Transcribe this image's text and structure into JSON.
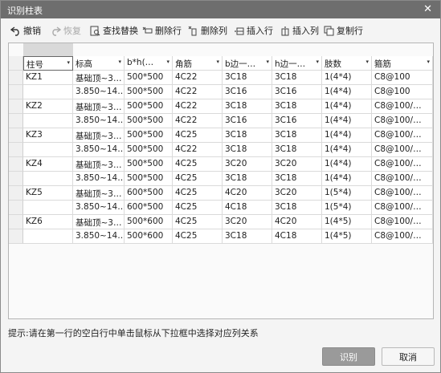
{
  "window": {
    "title": "识别柱表",
    "close_glyph": "✕"
  },
  "toolbar": {
    "undo": "撤销",
    "redo": "恢复",
    "find_replace": "查找替换",
    "delete_row": "删除行",
    "delete_col": "删除列",
    "insert_row": "插入行",
    "insert_col": "插入列",
    "copy_row": "复制行"
  },
  "table": {
    "headers": [
      "柱号",
      "标高",
      "b*h(…",
      "角筋",
      "b边一…",
      "h边一…",
      "肢数",
      "箍筋"
    ],
    "rows": [
      [
        "KZ1",
        "基础顶~3…",
        "500*500",
        "4C22",
        "3C18",
        "3C18",
        "1(4*4)",
        "C8@100"
      ],
      [
        "",
        "3.850~14…",
        "500*500",
        "4C22",
        "3C16",
        "3C16",
        "1(4*4)",
        "C8@100"
      ],
      [
        "KZ2",
        "基础顶~3…",
        "500*500",
        "4C22",
        "3C18",
        "3C18",
        "1(4*4)",
        "C8@100/…"
      ],
      [
        "",
        "3.850~14…",
        "500*500",
        "4C22",
        "3C16",
        "3C16",
        "1(4*4)",
        "C8@100/…"
      ],
      [
        "KZ3",
        "基础顶~3…",
        "500*500",
        "4C25",
        "3C18",
        "3C18",
        "1(4*4)",
        "C8@100/…"
      ],
      [
        "",
        "3.850~14…",
        "500*500",
        "4C22",
        "3C18",
        "3C18",
        "1(4*4)",
        "C8@100/…"
      ],
      [
        "KZ4",
        "基础顶~3…",
        "500*500",
        "4C25",
        "3C20",
        "3C20",
        "1(4*4)",
        "C8@100/…"
      ],
      [
        "",
        "3.850~14…",
        "500*500",
        "4C25",
        "3C18",
        "3C18",
        "1(4*4)",
        "C8@100/…"
      ],
      [
        "KZ5",
        "基础顶~3…",
        "600*500",
        "4C25",
        "4C20",
        "3C20",
        "1(5*4)",
        "C8@100/…"
      ],
      [
        "",
        "3.850~14…",
        "600*500",
        "4C25",
        "4C18",
        "3C18",
        "1(5*4)",
        "C8@100/…"
      ],
      [
        "KZ6",
        "基础顶~3…",
        "500*600",
        "4C25",
        "3C20",
        "4C20",
        "1(4*5)",
        "C8@100/…"
      ],
      [
        "",
        "3.850~14…",
        "500*600",
        "4C25",
        "3C18",
        "4C18",
        "1(4*5)",
        "C8@100/…"
      ]
    ]
  },
  "hint": "提示:请在第一行的空白行中单击鼠标从下拉框中选择对应列关系",
  "buttons": {
    "confirm": "识别",
    "cancel": "取消"
  },
  "colors": {
    "titlebar": "#6e6e6e",
    "primary_button": "#9a9a9a"
  }
}
